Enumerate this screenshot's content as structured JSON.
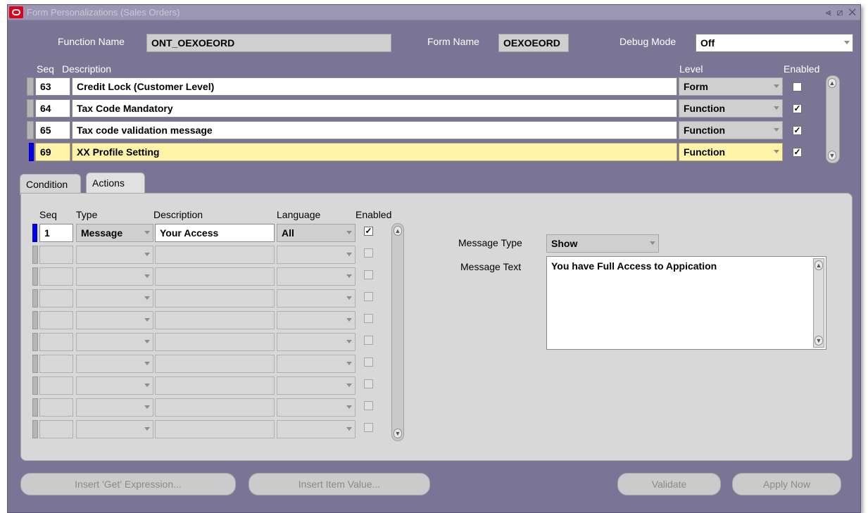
{
  "window": {
    "title": "Form Personalizations (Sales Orders)",
    "controls": "⪡ ⧄ ✕"
  },
  "header": {
    "function_name_label": "Function Name",
    "function_name_value": "ONT_OEXOEORD",
    "form_name_label": "Form Name",
    "form_name_value": "OEXOEORD",
    "debug_mode_label": "Debug Mode",
    "debug_mode_value": "Off"
  },
  "rules": {
    "columns": {
      "seq": "Seq",
      "description": "Description",
      "level": "Level",
      "enabled": "Enabled"
    },
    "rows": [
      {
        "seq": "63",
        "description": "Credit Lock (Customer Level)",
        "level": "Form",
        "enabled": false
      },
      {
        "seq": "64",
        "description": "Tax Code Mandatory",
        "level": "Function",
        "enabled": true
      },
      {
        "seq": "65",
        "description": "Tax code validation message",
        "level": "Function",
        "enabled": true
      },
      {
        "seq": "69",
        "description": "XX Profile Setting",
        "level": "Function",
        "enabled": true
      }
    ]
  },
  "tabs": [
    {
      "label": "Condition",
      "active": false
    },
    {
      "label": "Actions",
      "active": true
    }
  ],
  "actions": {
    "columns": {
      "seq": "Seq",
      "type": "Type",
      "description": "Description",
      "language": "Language",
      "enabled": "Enabled"
    },
    "rows": [
      {
        "seq": "1",
        "type": "Message",
        "description": "Your Access",
        "language": "All",
        "enabled": true
      }
    ],
    "empty_rows": 9
  },
  "message": {
    "type_label": "Message Type",
    "type_value": "Show",
    "text_label": "Message Text",
    "text_value": "You have Full Access to Appication"
  },
  "buttons": {
    "insert_get_expression": "Insert 'Get' Expression...",
    "insert_item_value": "Insert Item Value...",
    "validate": "Validate",
    "apply_now": "Apply Now"
  },
  "colors": {
    "window_bg": "#7a7595",
    "current_record": "#fef3a6",
    "record_indicator": "#0000ee",
    "oracle_icon": "#e0001a"
  }
}
